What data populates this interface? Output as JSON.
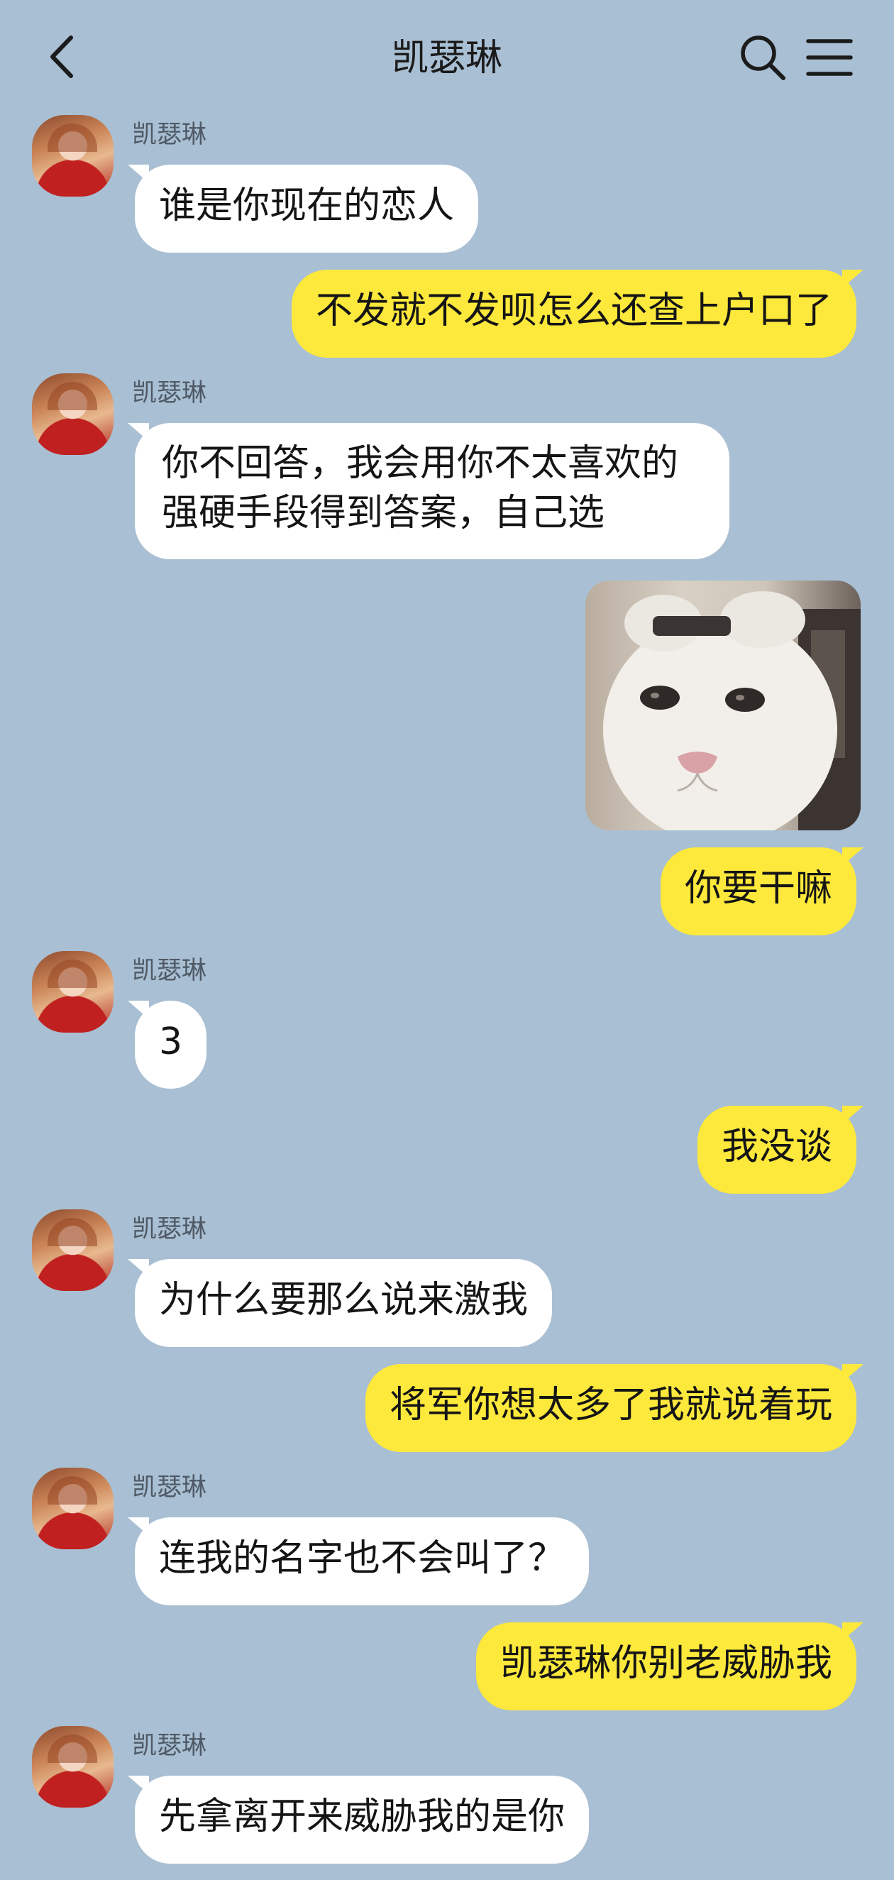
{
  "header": {
    "title": "凯瑟琳"
  },
  "icons": {
    "back": "chevron-left-icon",
    "search": "search-icon",
    "menu": "hamburger-menu-icon"
  },
  "contact": {
    "name": "凯瑟琳"
  },
  "messages": [
    {
      "side": "in",
      "sender": "凯瑟琳",
      "text": "谁是你现在的恋人"
    },
    {
      "side": "out",
      "text": "不发就不发呗怎么还查上户口了"
    },
    {
      "side": "in",
      "sender": "凯瑟琳",
      "text": "你不回答，我会用你不太喜欢的强硬手段得到答案，自己选"
    },
    {
      "side": "out",
      "type": "image",
      "subject": "white cat face meme"
    },
    {
      "side": "out",
      "text": "你要干嘛"
    },
    {
      "side": "in",
      "sender": "凯瑟琳",
      "text": "3"
    },
    {
      "side": "out",
      "text": "我没谈"
    },
    {
      "side": "in",
      "sender": "凯瑟琳",
      "text": "为什么要那么说来激我"
    },
    {
      "side": "out",
      "text": "将军你想太多了我就说着玩"
    },
    {
      "side": "in",
      "sender": "凯瑟琳",
      "text": "连我的名字也不会叫了？"
    },
    {
      "side": "out",
      "text": "凯瑟琳你别老威胁我"
    },
    {
      "side": "in",
      "sender": "凯瑟琳",
      "text": "先拿离开来威胁我的是你"
    }
  ],
  "colors": {
    "background": "#a9bfd3",
    "incoming_bubble": "#ffffff",
    "outgoing_bubble": "#fde83c"
  }
}
